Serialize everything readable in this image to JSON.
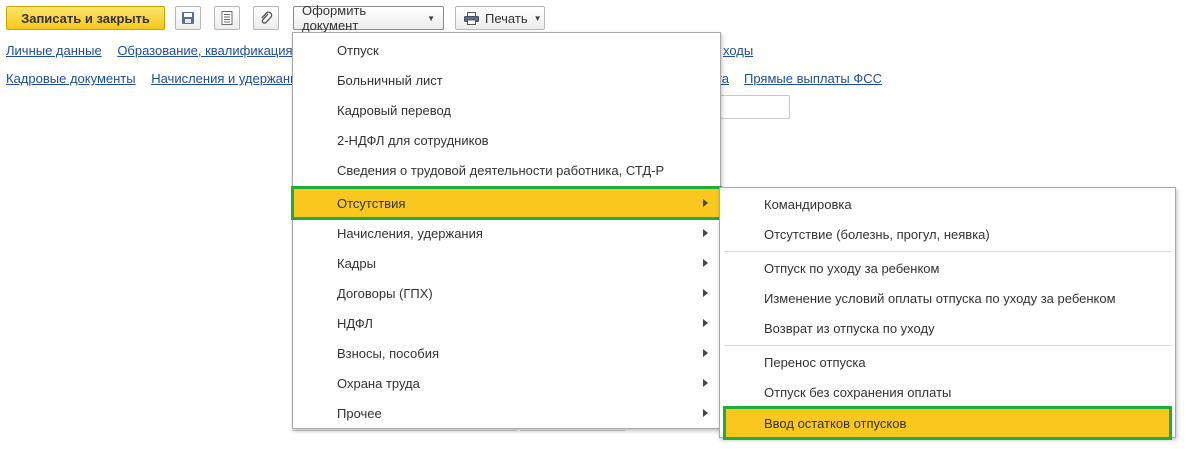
{
  "toolbar": {
    "save_close_label": "Записать и закрыть",
    "save_icon": "floppy-disk-icon",
    "list_icon": "document-list-icon",
    "attach_icon": "paperclip-icon",
    "create_doc_label": "Оформить документ",
    "print_label": "Печать",
    "print_icon": "printer-icon"
  },
  "links_row1": [
    "Личные данные",
    "Образование, квалификация",
    "ходы"
  ],
  "links_row2": [
    "Кадровые документы",
    "Начисления и удержани",
    "ата",
    "Прямые выплаты ФСС"
  ],
  "menu": {
    "items": [
      {
        "label": "Отпуск",
        "submenu": false
      },
      {
        "label": "Больничный лист",
        "submenu": false
      },
      {
        "label": "Кадровый перевод",
        "submenu": false
      },
      {
        "label": "2-НДФЛ для сотрудников",
        "submenu": false
      },
      {
        "label": "Сведения о трудовой деятельности работника, СТД-Р",
        "submenu": false
      },
      {
        "label": "Отсутствия",
        "submenu": true,
        "highlighted": true
      },
      {
        "label": "Начисления, удержания",
        "submenu": true
      },
      {
        "label": "Кадры",
        "submenu": true
      },
      {
        "label": "Договоры (ГПХ)",
        "submenu": true
      },
      {
        "label": "НДФЛ",
        "submenu": true
      },
      {
        "label": "Взносы, пособия",
        "submenu": true
      },
      {
        "label": "Охрана труда",
        "submenu": true
      },
      {
        "label": "Прочее",
        "submenu": true
      }
    ]
  },
  "submenu": {
    "items": [
      {
        "label": "Командировка"
      },
      {
        "label": "Отсутствие (болезнь, прогул, неявка)"
      },
      {
        "label": "Отпуск по уходу за ребенком"
      },
      {
        "label": "Изменение условий оплаты отпуска по уходу за ребенком"
      },
      {
        "label": "Возврат из отпуска по уходу"
      },
      {
        "label": "Перенос отпуска"
      },
      {
        "label": "Отпуск без сохранения оплаты"
      },
      {
        "label": "Ввод остатков отпусков",
        "highlighted": true
      }
    ]
  },
  "colors": {
    "primary_button": "#f6c81a",
    "highlight": "#f9c81f",
    "annotation_frame": "#1fae3a",
    "link": "#1d4e9c"
  }
}
